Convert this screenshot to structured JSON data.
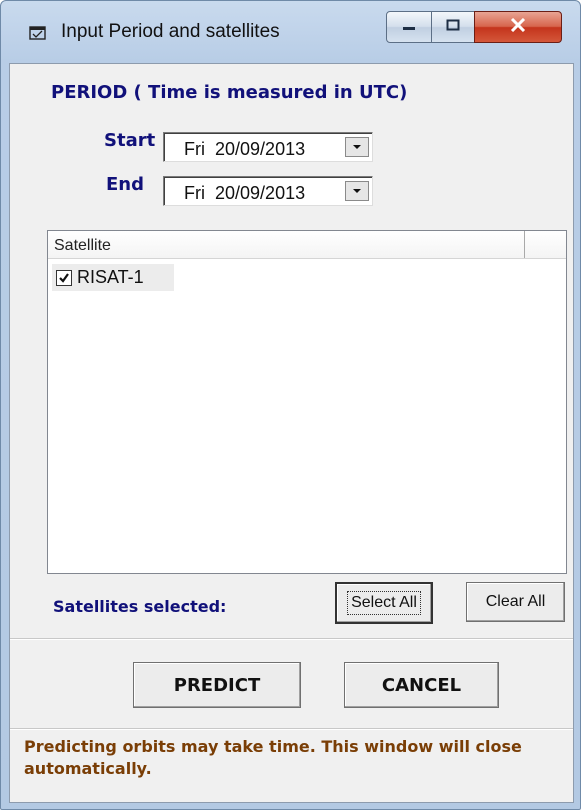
{
  "window": {
    "title": "Input Period and satellites",
    "icon": "window-app-icon"
  },
  "period": {
    "heading": "PERIOD   ( Time is measured in UTC)",
    "start_label": "Start",
    "start_day": "Fri",
    "start_date": "20/09/2013",
    "end_label": "End",
    "end_day": "Fri",
    "end_date": "20/09/2013"
  },
  "satellites": {
    "column_header": "Satellite",
    "items": [
      {
        "name": "RISAT-1",
        "checked": true
      }
    ],
    "selected_label": "Satellites selected:",
    "select_all_label": "Select All",
    "clear_all_label": "Clear All"
  },
  "actions": {
    "predict_label": "PREDICT",
    "cancel_label": "CANCEL"
  },
  "note": "Predicting orbits may take time. This window will close automatically.",
  "colors": {
    "label_blue": "#11117a",
    "note_brown": "#7a3e06",
    "close_red": "#c4341c"
  }
}
